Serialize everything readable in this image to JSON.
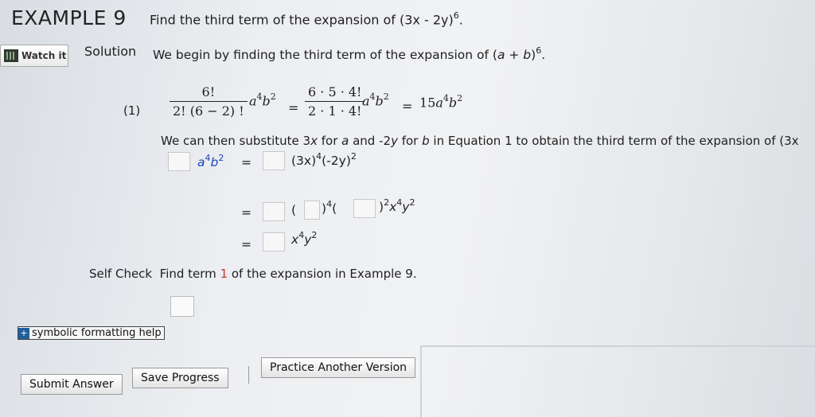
{
  "header": {
    "example_title": "EXAMPLE 9",
    "problem_prefix": "Find the third term of the expansion of (3x - 2y)",
    "problem_exp": "6",
    "problem_suffix": "."
  },
  "watch": {
    "label": "Watch it"
  },
  "solution": {
    "label": "Solution",
    "begin_prefix": "We begin by finding the third term of the expansion of (",
    "begin_a": "a",
    "begin_plus": " + ",
    "begin_b": "b",
    "begin_close": ")",
    "begin_exp": "6",
    "begin_suffix": "."
  },
  "equation1": {
    "number": "(1)",
    "frac1_num": "6!",
    "frac1_den": "2! (6 − 2) !",
    "term_a": "a",
    "term_a_exp": "4",
    "term_b": "b",
    "term_b_exp": "2",
    "equals": "=",
    "frac2_num": "6 · 5 · 4!",
    "frac2_den": "2 · 1 · 4!",
    "result_coef": "15",
    "result_a": "a",
    "result_a_exp": "4",
    "result_b": "b",
    "result_b_exp": "2"
  },
  "substitute": {
    "part1": "We can then substitute 3",
    "x": "x",
    "part2": " for ",
    "a": "a",
    "part3": " and -2",
    "y": "y",
    "part4": " for ",
    "b": "b",
    "part5": " in Equation 1 to obtain the third term of the expansion of (3x"
  },
  "rows": {
    "row1_a": "a",
    "row1_a_exp": "4",
    "row1_b": "b",
    "row1_b_exp": "2",
    "equals": "=",
    "row1_rhs": "(3x)",
    "row1_rhs_exp1": "4",
    "row1_rhs_mid": "(-2y)",
    "row1_rhs_exp2": "2",
    "row2_open": "(",
    "row2_close1": ")",
    "row2_exp1": "4",
    "row2_open2": "(",
    "row2_close2": ")",
    "row2_exp2": "2",
    "row2_x": "x",
    "row2_x_exp": "4",
    "row2_y": "y",
    "row2_y_exp": "2",
    "row3_x": "x",
    "row3_x_exp": "4",
    "row3_y": "y",
    "row3_y_exp": "2"
  },
  "self_check": {
    "label": "Self Check",
    "prefix": "Find term ",
    "term_number": "1",
    "suffix": " of the expansion in Example 9."
  },
  "help": {
    "icon": "+",
    "label": "symbolic formatting help"
  },
  "buttons": {
    "submit": "Submit Answer",
    "save": "Save Progress",
    "practice": "Practice Another Version"
  }
}
